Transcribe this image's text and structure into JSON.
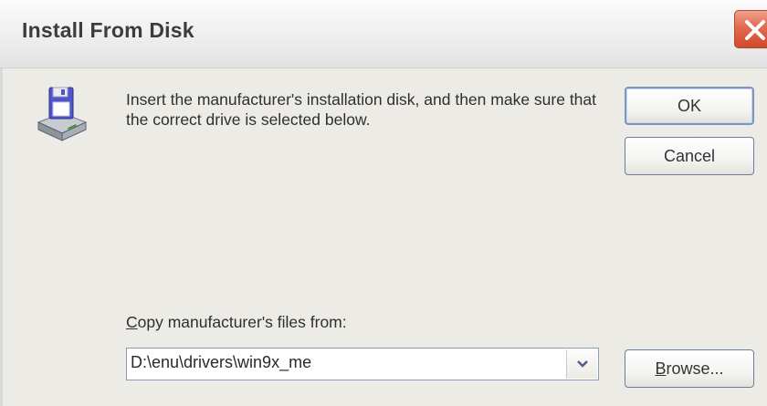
{
  "window": {
    "title": "Install From Disk"
  },
  "dialog": {
    "message": "Insert the manufacturer's installation disk, and then make sure that the correct drive is selected below.",
    "ok_label": "OK",
    "cancel_label": "Cancel",
    "copy_label_accel": "C",
    "copy_label_rest": "opy manufacturer's files from:",
    "path_value": "D:\\enu\\drivers\\win9x_me",
    "browse_accel": "B",
    "browse_rest": "rowse..."
  },
  "icons": {
    "disk": "floppy-disk-drive-icon",
    "close": "close-icon",
    "dropdown": "chevron-down-icon"
  },
  "colors": {
    "close_button": "#d9573b",
    "dialog_background": "#ecebe6",
    "button_border": "#6a7d9a"
  }
}
